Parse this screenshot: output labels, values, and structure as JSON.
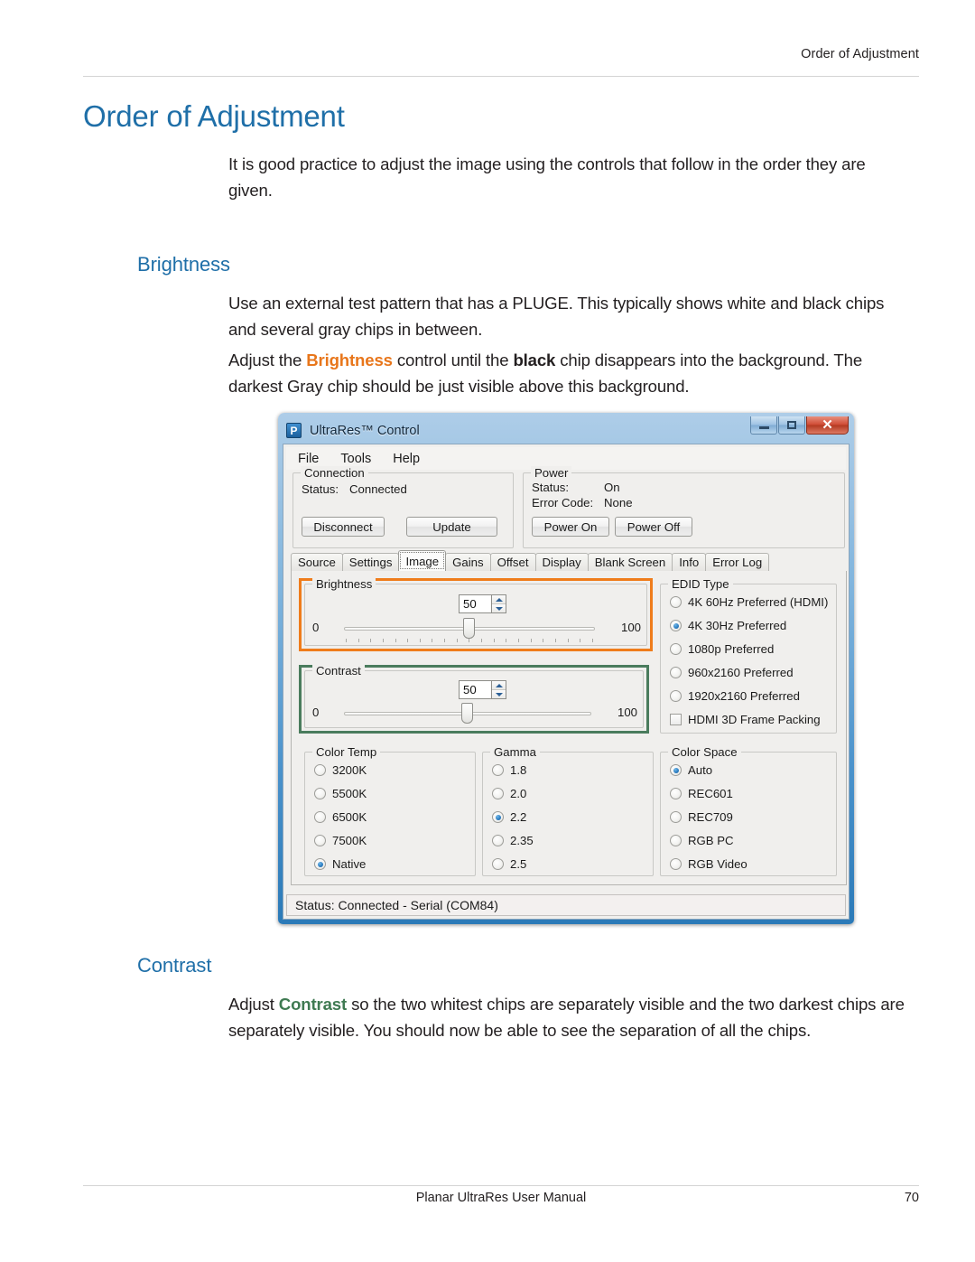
{
  "page": {
    "running_head": "Order of Adjustment",
    "title": "Order of Adjustment",
    "intro": "It is good practice to adjust the image using the controls that follow in the order they are given.",
    "footer_text": "Planar UltraRes User Manual",
    "footer_page": "70"
  },
  "sections": {
    "brightness": {
      "heading": "Brightness",
      "para1": "Use an external test pattern that has a PLUGE. This typically shows white and black chips and several gray chips in between.",
      "para2_a": "Adjust the ",
      "para2_kw": "Brightness",
      "para2_b": " control until the ",
      "para2_bold": "black",
      "para2_c": " chip disappears into the background. The darkest Gray chip should be just visible above this background."
    },
    "contrast": {
      "heading": "Contrast",
      "para_a": "Adjust ",
      "para_kw": "Contrast",
      "para_b": " so the two whitest chips are separately visible and the two darkest chips are separately visible. You should now be able to see the separation of all the chips."
    }
  },
  "app": {
    "icon_letter": "P",
    "title": "UltraRes™ Control",
    "window_buttons": {
      "minimize": "minimize-icon",
      "maximize": "maximize-icon",
      "close": "✕"
    },
    "menu": [
      "File",
      "Tools",
      "Help"
    ],
    "connection": {
      "legend": "Connection",
      "status_label": "Status:",
      "status_value": "Connected",
      "disconnect_button": "Disconnect",
      "update_button": "Update"
    },
    "power": {
      "legend": "Power",
      "status_label": "Status:",
      "status_value": "On",
      "error_label": "Error Code:",
      "error_value": "None",
      "power_on_button": "Power On",
      "power_off_button": "Power Off"
    },
    "tabs": [
      {
        "label": "Source",
        "active": false
      },
      {
        "label": "Settings",
        "active": false
      },
      {
        "label": "Image",
        "active": true
      },
      {
        "label": "Gains",
        "active": false
      },
      {
        "label": "Offset",
        "active": false
      },
      {
        "label": "Display",
        "active": false
      },
      {
        "label": "Blank Screen",
        "active": false
      },
      {
        "label": "Info",
        "active": false
      },
      {
        "label": "Error Log",
        "active": false
      }
    ],
    "brightness_group": {
      "legend": "Brightness",
      "value": "50",
      "min": "0",
      "max": "100",
      "highlight_color": "#ef7c1b"
    },
    "contrast_group": {
      "legend": "Contrast",
      "value": "50",
      "min": "0",
      "max": "100",
      "highlight_color": "#4a7c5d"
    },
    "edid": {
      "legend": "EDID Type",
      "options": [
        {
          "label": "4K 60Hz Preferred (HDMI)",
          "selected": false
        },
        {
          "label": "4K 30Hz Preferred",
          "selected": true
        },
        {
          "label": "1080p Preferred",
          "selected": false
        },
        {
          "label": "960x2160 Preferred",
          "selected": false
        },
        {
          "label": "1920x2160 Preferred",
          "selected": false
        }
      ],
      "checkbox": {
        "label": "HDMI 3D Frame Packing",
        "checked": false
      }
    },
    "color_temp": {
      "legend": "Color Temp",
      "options": [
        {
          "label": "3200K",
          "selected": false
        },
        {
          "label": "5500K",
          "selected": false
        },
        {
          "label": "6500K",
          "selected": false
        },
        {
          "label": "7500K",
          "selected": false
        },
        {
          "label": "Native",
          "selected": true
        }
      ]
    },
    "gamma": {
      "legend": "Gamma",
      "options": [
        {
          "label": "1.8",
          "selected": false
        },
        {
          "label": "2.0",
          "selected": false
        },
        {
          "label": "2.2",
          "selected": true
        },
        {
          "label": "2.35",
          "selected": false
        },
        {
          "label": "2.5",
          "selected": false
        }
      ]
    },
    "color_space": {
      "legend": "Color Space",
      "options": [
        {
          "label": "Auto",
          "selected": true
        },
        {
          "label": "REC601",
          "selected": false
        },
        {
          "label": "REC709",
          "selected": false
        },
        {
          "label": "RGB PC",
          "selected": false
        },
        {
          "label": "RGB Video",
          "selected": false
        }
      ]
    },
    "statusbar": "Status:  Connected - Serial (COM84)"
  }
}
